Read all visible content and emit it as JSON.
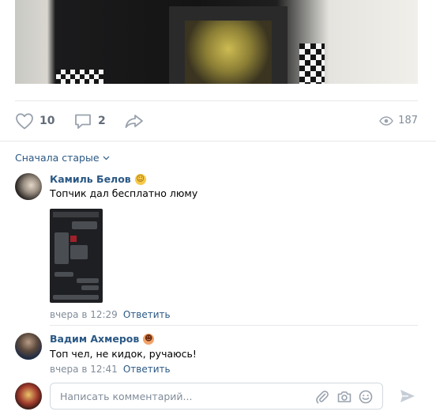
{
  "post": {
    "likes": "10",
    "comments": "2",
    "views": "187"
  },
  "sort": {
    "label": "Сначала старые"
  },
  "comments": [
    {
      "author": "Камиль Белов",
      "text": "Топчик дал бесплатно люму",
      "time": "вчера в 12:29",
      "reply": "Ответить"
    },
    {
      "author": "Вадим Ахмеров",
      "text": "Топ чел, не кидок, ручаюсь!",
      "time": "вчера в 12:41",
      "reply": "Ответить"
    }
  ],
  "composer": {
    "placeholder": "Написать комментарий..."
  },
  "colors": {
    "link": "#2a5885",
    "muted": "#818c99",
    "border": "#e7e8ec"
  },
  "icons": [
    "heart-icon",
    "comment-icon",
    "share-icon",
    "eye-icon",
    "chevron-down-icon",
    "paperclip-icon",
    "camera-icon",
    "emoji-icon",
    "send-icon"
  ]
}
